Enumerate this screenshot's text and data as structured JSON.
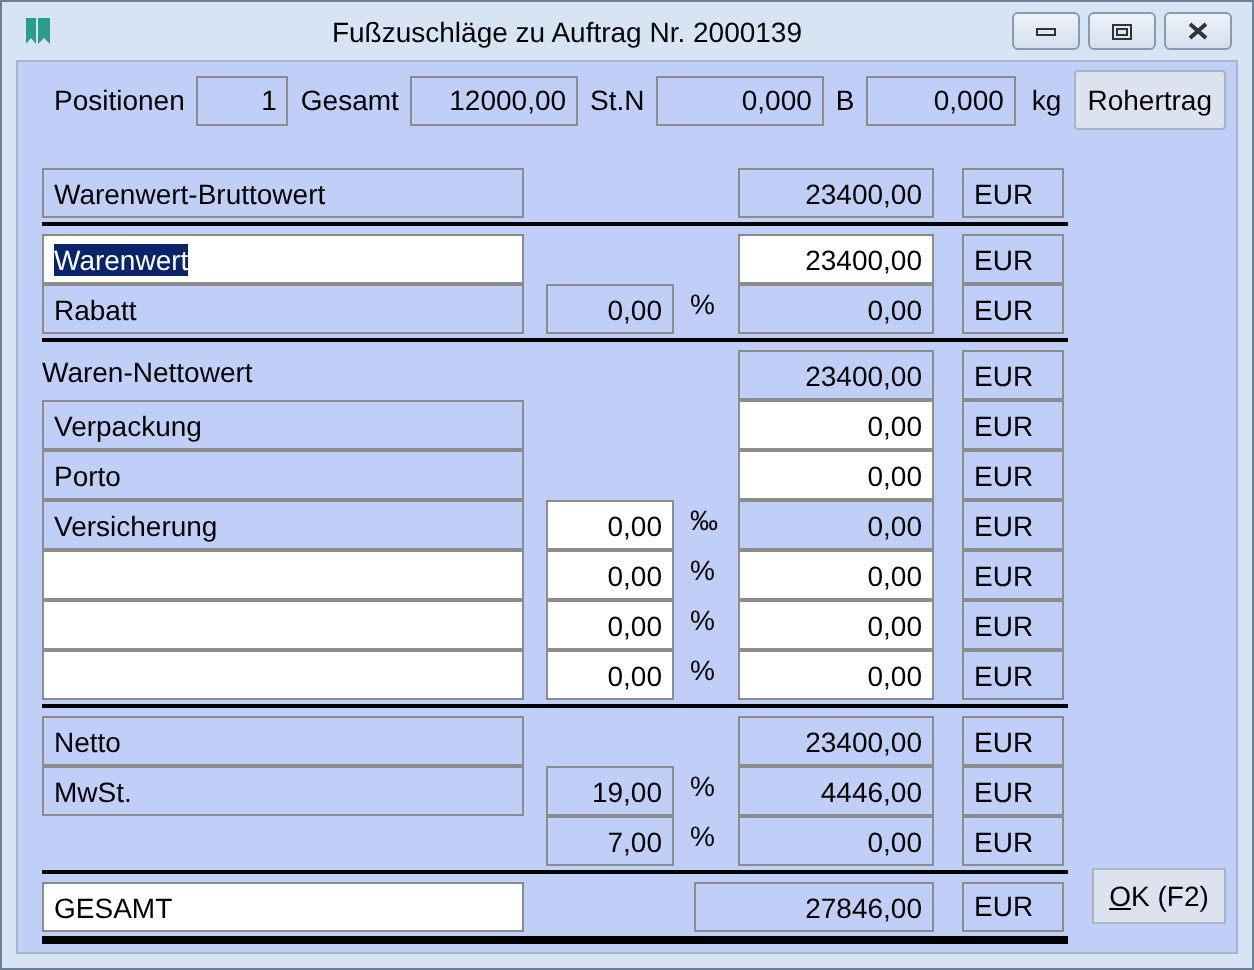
{
  "window": {
    "title": "Fußzuschläge zu Auftrag Nr. 2000139"
  },
  "summary": [
    {
      "label": "Positionen",
      "value": "1"
    },
    {
      "label": "Gesamt",
      "value": "12000,00"
    },
    {
      "label": "St.N",
      "value": "0,000"
    },
    {
      "label": "B",
      "value": "0,000"
    }
  ],
  "weight_unit": "kg",
  "gross_profit_button": "Rohertrag",
  "sections": [
    {
      "rows": [
        {
          "kind": "line",
          "label": {
            "kind": "display",
            "text": "Warenwert-Bruttowert",
            "selected": false
          },
          "amount": "23400,00",
          "amount_editable": false,
          "currency": "EUR"
        }
      ]
    },
    {
      "rows": [
        {
          "kind": "line",
          "label": {
            "kind": "input",
            "text": "Warenwert",
            "selected": true
          },
          "amount": "23400,00",
          "amount_editable": true,
          "currency": "EUR"
        },
        {
          "kind": "line",
          "label": {
            "kind": "display",
            "text": "Rabatt",
            "selected": false
          },
          "rate": "0,00",
          "rate_editable": false,
          "unit": "%",
          "amount": "0,00",
          "amount_editable": false,
          "currency": "EUR"
        }
      ]
    },
    {
      "rows": [
        {
          "kind": "line",
          "label": {
            "kind": "plain",
            "text": "Waren-Nettowert"
          },
          "amount": "23400,00",
          "amount_editable": false,
          "currency": "EUR"
        },
        {
          "kind": "line",
          "label": {
            "kind": "display",
            "text": "Verpackung",
            "selected": false
          },
          "amount": "0,00",
          "amount_editable": true,
          "currency": "EUR"
        },
        {
          "kind": "line",
          "label": {
            "kind": "display",
            "text": "Porto",
            "selected": false
          },
          "amount": "0,00",
          "amount_editable": true,
          "currency": "EUR"
        },
        {
          "kind": "line",
          "label": {
            "kind": "display",
            "text": "Versicherung",
            "selected": false
          },
          "rate": "0,00",
          "rate_editable": true,
          "unit": "‰",
          "amount": "0,00",
          "amount_editable": false,
          "currency": "EUR"
        },
        {
          "kind": "line",
          "label": {
            "kind": "input"
          },
          "rate": "0,00",
          "rate_editable": true,
          "unit": "%",
          "amount": "0,00",
          "amount_editable": true,
          "currency": "EUR"
        },
        {
          "kind": "line",
          "label": {
            "kind": "input"
          },
          "rate": "0,00",
          "rate_editable": true,
          "unit": "%",
          "amount": "0,00",
          "amount_editable": true,
          "currency": "EUR"
        },
        {
          "kind": "line",
          "label": {
            "kind": "input"
          },
          "rate": "0,00",
          "rate_editable": true,
          "unit": "%",
          "amount": "0,00",
          "amount_editable": true,
          "currency": "EUR"
        }
      ]
    },
    {
      "rows": [
        {
          "kind": "line",
          "label": {
            "kind": "display",
            "text": "Netto",
            "selected": false
          },
          "amount": "23400,00",
          "amount_editable": false,
          "currency": "EUR"
        },
        {
          "kind": "line",
          "label": {
            "kind": "display",
            "text": "MwSt.",
            "selected": false
          },
          "rate": "19,00",
          "rate_editable": false,
          "unit": "%",
          "amount": "4446,00",
          "amount_editable": false,
          "currency": "EUR"
        },
        {
          "kind": "line",
          "rate": "7,00",
          "rate_editable": false,
          "unit": "%",
          "amount": "0,00",
          "amount_editable": false,
          "currency": "EUR"
        }
      ]
    },
    {
      "rows": [
        {
          "kind": "total",
          "label": {
            "kind": "input",
            "text": "GESAMT",
            "selected": false
          },
          "amount": "27846,00",
          "amount_editable": false,
          "currency": "EUR"
        }
      ]
    }
  ],
  "ok_button": {
    "access_key": "O",
    "rest": "K (F2)"
  }
}
